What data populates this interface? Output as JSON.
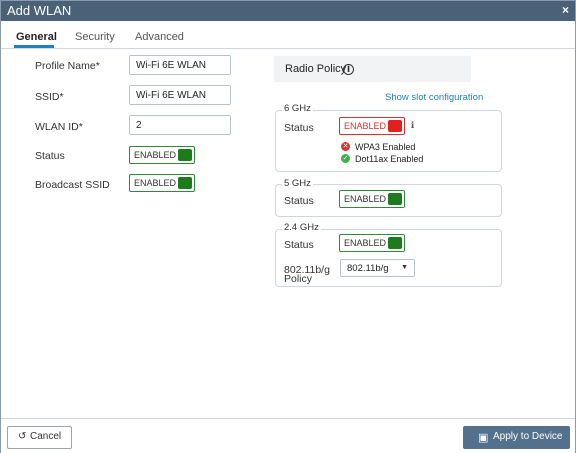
{
  "dialog": {
    "title": "Add WLAN",
    "close_icon": "×"
  },
  "tabs": [
    {
      "label": "General",
      "active": true
    },
    {
      "label": "Security",
      "active": false
    },
    {
      "label": "Advanced",
      "active": false
    }
  ],
  "general": {
    "profile_name": {
      "label": "Profile Name*",
      "value": "Wi-Fi 6E WLAN"
    },
    "ssid": {
      "label": "SSID*",
      "value": "Wi-Fi 6E WLAN"
    },
    "wlan_id": {
      "label": "WLAN ID*",
      "value": "2"
    },
    "status": {
      "label": "Status",
      "toggle": "ENABLED"
    },
    "broadcast_ssid": {
      "label": "Broadcast SSID",
      "toggle": "ENABLED"
    }
  },
  "radio_policy": {
    "title": "Radio Policy",
    "show_slot_link": "Show slot configuration",
    "band_6ghz": {
      "legend": "6 GHz",
      "status_label": "Status",
      "toggle": "ENABLED",
      "checks": [
        {
          "state": "fail",
          "text": "WPA3 Enabled"
        },
        {
          "state": "ok",
          "text": "Dot11ax Enabled"
        }
      ]
    },
    "band_5ghz": {
      "legend": "5 GHz",
      "status_label": "Status",
      "toggle": "ENABLED"
    },
    "band_24ghz": {
      "legend": "2.4 GHz",
      "status_label": "Status",
      "toggle": "ENABLED",
      "policy_label_line1": "802.11b/g",
      "policy_label_line2": "Policy",
      "policy_value": "802.11b/g"
    }
  },
  "footer": {
    "cancel_label": "Cancel",
    "apply_label": "Apply to Device"
  },
  "colors": {
    "titlebar": "#4a6178",
    "tab_accent": "#1f7fc1",
    "toggle_green": "#1d7a1d",
    "toggle_red": "#e0211d",
    "apply_button": "#53708c"
  }
}
